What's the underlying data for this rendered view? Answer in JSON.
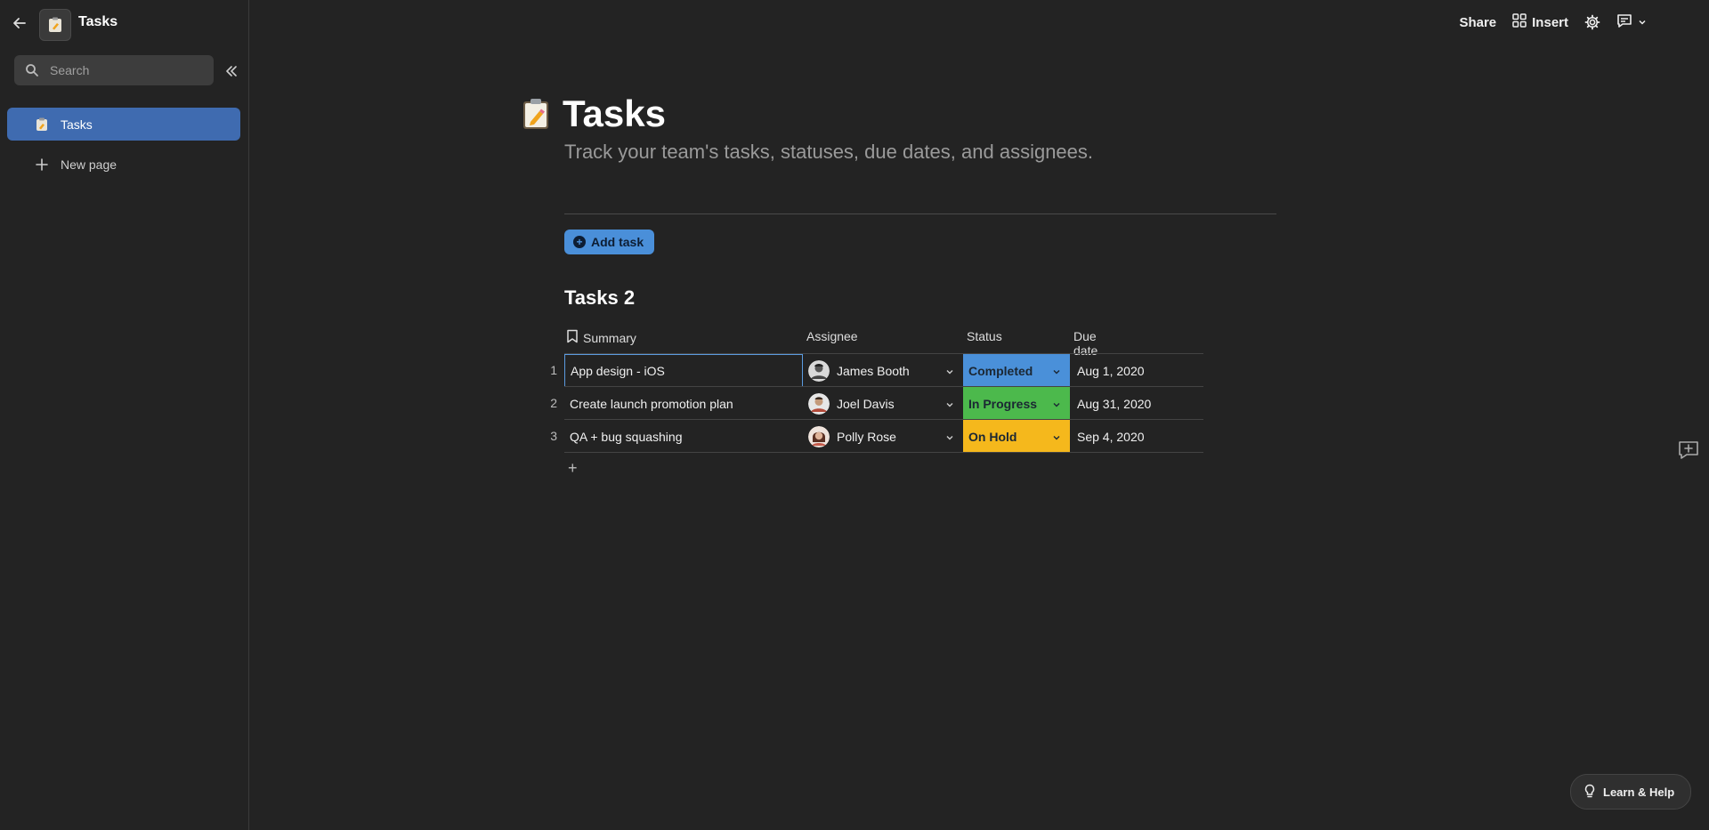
{
  "sidebar": {
    "doc_title": "Tasks",
    "search_placeholder": "Search",
    "items": [
      {
        "label": "Tasks",
        "icon": "clipboard-icon"
      },
      {
        "label": "New page",
        "icon": "plus-icon"
      }
    ]
  },
  "topbar": {
    "share_label": "Share",
    "insert_label": "Insert"
  },
  "page": {
    "title": "Tasks",
    "subtitle": "Track your team's tasks, statuses, due dates, and assignees.",
    "add_task_label": "Add task"
  },
  "table": {
    "title": "Tasks 2",
    "columns": [
      "Summary",
      "Assignee",
      "Status",
      "Due date"
    ],
    "rows": [
      {
        "num": "1",
        "summary": "App design - iOS",
        "assignee": "James Booth",
        "status": "Completed",
        "status_color": "#4a90d9",
        "due": "Aug 1, 2020"
      },
      {
        "num": "2",
        "summary": "Create launch promotion plan",
        "assignee": "Joel Davis",
        "status": "In Progress",
        "status_color": "#4cb94c",
        "due": "Aug 31, 2020"
      },
      {
        "num": "3",
        "summary": "QA + bug squashing",
        "assignee": "Polly Rose",
        "status": "On Hold",
        "status_color": "#f5b81c",
        "due": "Sep 4, 2020"
      }
    ],
    "add_row_symbol": "+"
  },
  "learn_help_label": "Learn & Help",
  "colors": {
    "background": "#232323",
    "accent": "#3f6bb0",
    "add_task": "#4a8fd9"
  }
}
